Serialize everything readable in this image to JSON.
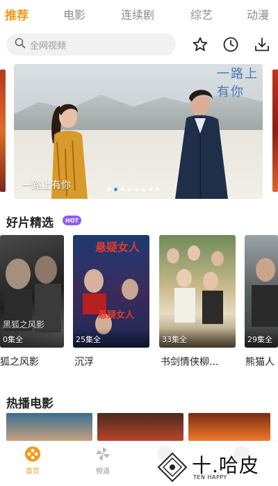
{
  "tabs": [
    {
      "label": "推荐",
      "active": true
    },
    {
      "label": "电影",
      "active": false
    },
    {
      "label": "连续剧",
      "active": false
    },
    {
      "label": "综艺",
      "active": false
    },
    {
      "label": "动漫",
      "active": false
    }
  ],
  "search": {
    "placeholder": "全网视频"
  },
  "header_icons": [
    "star-icon",
    "clock-icon",
    "download-icon"
  ],
  "banner": {
    "caption": "一路上有你",
    "logo_text": "一路上有你",
    "dot_count": 8,
    "active_dot": 2
  },
  "featured": {
    "title": "好片精选",
    "badge": "HOT",
    "items": [
      {
        "episodes": "0集全",
        "title": "狐之风影",
        "poster_text": "黑狐之风影"
      },
      {
        "episodes": "25集全",
        "title": "沉浮",
        "poster_text": "悬疑女人"
      },
      {
        "episodes": "33集全",
        "title": "书剑情侠柳...",
        "poster_text": ""
      },
      {
        "episodes": "29集全",
        "title": "熊猫人",
        "poster_text": ""
      }
    ]
  },
  "hot_movies": {
    "title": "热播电影"
  },
  "bottom_nav": [
    {
      "label": "首页",
      "icon": "home-film-reel-icon",
      "active": true
    },
    {
      "label": "频道",
      "icon": "channel-pinwheel-icon",
      "active": false
    }
  ],
  "watermark": {
    "text": "十.哈皮",
    "sub": "TEN HAPPY"
  },
  "colors": {
    "accent": "#f29a17",
    "hot_badge": "#8e5cf7",
    "dot_active": "#3a8ee6",
    "search_bg": "#f1f1f3"
  }
}
